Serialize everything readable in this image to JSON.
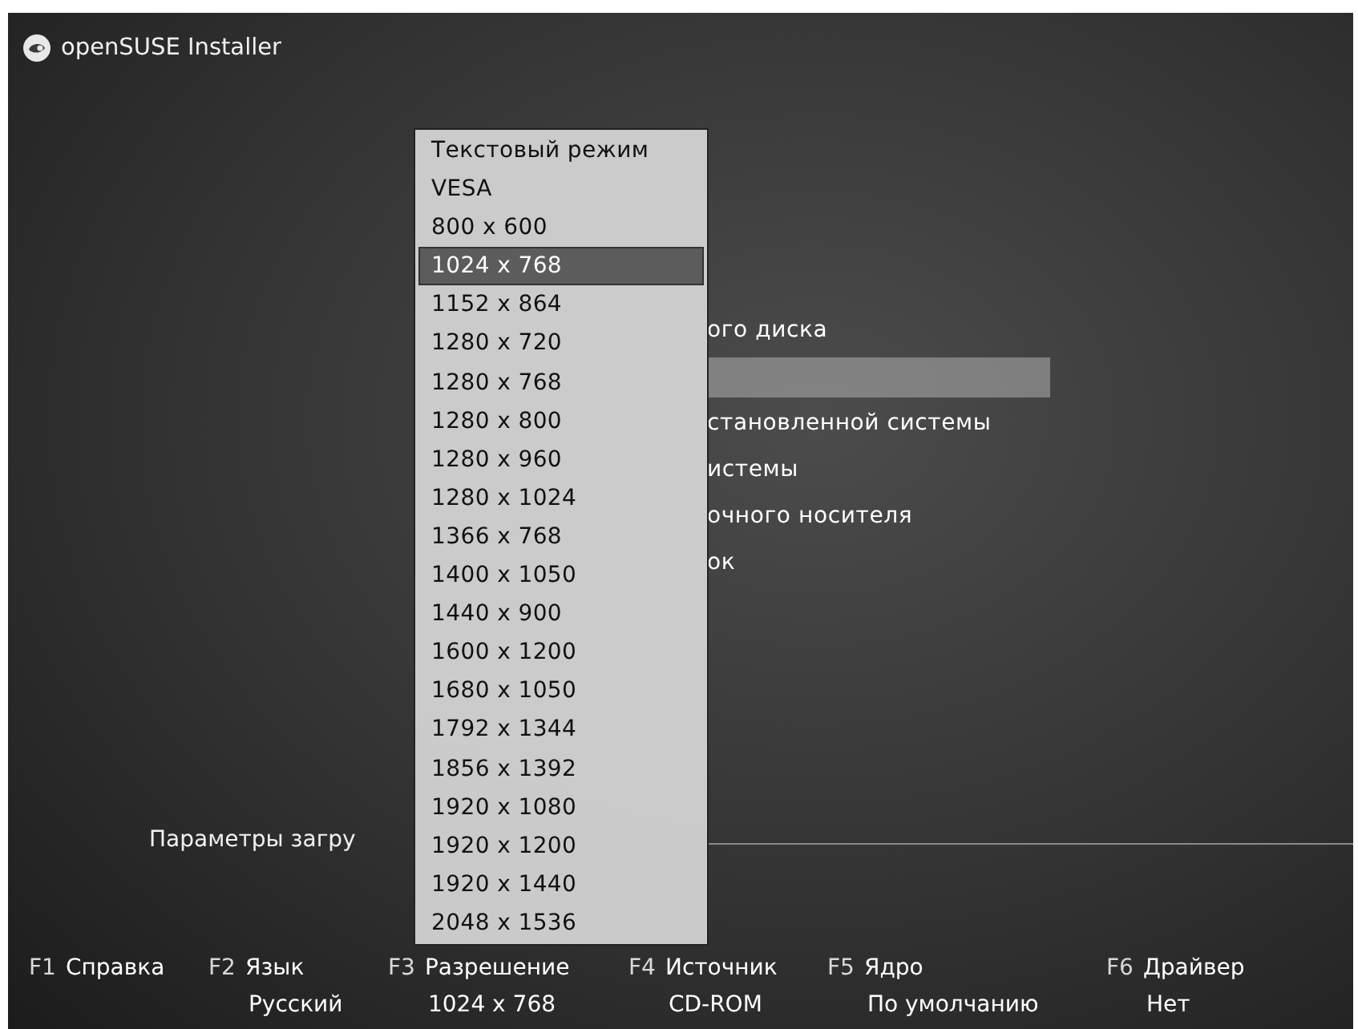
{
  "header": {
    "title": "openSUSE Installer"
  },
  "boot_menu": [
    {
      "label": "ого диска",
      "selected": false
    },
    {
      "selected": true
    },
    {
      "label": "становленной системы",
      "selected": false
    },
    {
      "label": "истемы",
      "selected": false
    },
    {
      "label": "очного носителя",
      "selected": false
    },
    {
      "label": "ок",
      "selected": false
    }
  ],
  "boot_options": {
    "label": "Параметры загру"
  },
  "resolution_dropdown": [
    {
      "label": "Текстовый режим",
      "selected": false
    },
    {
      "label": "VESA",
      "selected": false
    },
    {
      "label": "800 x 600",
      "selected": false
    },
    {
      "label": "1024 x 768",
      "selected": true
    },
    {
      "label": "1152 x 864",
      "selected": false
    },
    {
      "label": "1280 x 720",
      "selected": false
    },
    {
      "label": "1280 x 768",
      "selected": false
    },
    {
      "label": "1280 x 800",
      "selected": false
    },
    {
      "label": "1280 x 960",
      "selected": false
    },
    {
      "label": "1280 x 1024",
      "selected": false
    },
    {
      "label": "1366 x 768",
      "selected": false
    },
    {
      "label": "1400 x 1050",
      "selected": false
    },
    {
      "label": "1440 x 900",
      "selected": false
    },
    {
      "label": "1600 x 1200",
      "selected": false
    },
    {
      "label": "1680 x 1050",
      "selected": false
    },
    {
      "label": "1792 x 1344",
      "selected": false
    },
    {
      "label": "1856 x 1392",
      "selected": false
    },
    {
      "label": "1920 x 1080",
      "selected": false
    },
    {
      "label": "1920 x 1200",
      "selected": false
    },
    {
      "label": "1920 x 1440",
      "selected": false
    },
    {
      "label": "2048 x 1536",
      "selected": false
    }
  ],
  "function_keys": [
    {
      "key": "F1",
      "label": "Справка"
    },
    {
      "key": "F2",
      "label": "Язык",
      "value": "Русский"
    },
    {
      "key": "F3",
      "label": "Разрешение",
      "value": "1024 x 768"
    },
    {
      "key": "F4",
      "label": "Источник",
      "value": "CD-ROM"
    },
    {
      "key": "F5",
      "label": "Ядро",
      "value": "По умолчанию"
    },
    {
      "key": "F6",
      "label": "Драйвер",
      "value": "Нет"
    }
  ]
}
